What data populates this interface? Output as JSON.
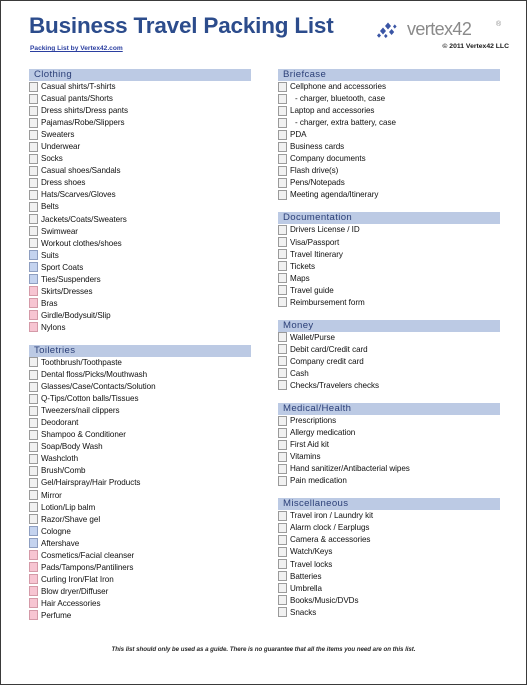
{
  "header": {
    "title": "Business Travel Packing List",
    "subtitle_link": "Packing List by Vertex42.com",
    "logo_word": "vertex42",
    "logo_tm": "®",
    "copyright": "© 2011 Vertex42 LLC"
  },
  "colors": {
    "title": "#2c4c8c",
    "section_header_bg": "#bccae4",
    "section_header_text": "#2b3f77",
    "checkbox_default": "#f1f1f1",
    "checkbox_mens": "#c4d3ef",
    "checkbox_womens": "#f7c5d2",
    "link": "#2b3fa0"
  },
  "footer": {
    "note": "This list should only be used as a guide. There is no guarantee that all the items you need are on this list."
  },
  "columns": [
    {
      "sections": [
        {
          "title": "Clothing",
          "items": [
            {
              "label": "Casual shirts/T-shirts",
              "box": "default",
              "sub": false
            },
            {
              "label": "Casual pants/Shorts",
              "box": "default",
              "sub": false
            },
            {
              "label": "Dress shirts/Dress pants",
              "box": "default",
              "sub": false
            },
            {
              "label": "Pajamas/Robe/Slippers",
              "box": "default",
              "sub": false
            },
            {
              "label": "Sweaters",
              "box": "default",
              "sub": false
            },
            {
              "label": "Underwear",
              "box": "default",
              "sub": false
            },
            {
              "label": "Socks",
              "box": "default",
              "sub": false
            },
            {
              "label": "Casual shoes/Sandals",
              "box": "default",
              "sub": false
            },
            {
              "label": "Dress shoes",
              "box": "default",
              "sub": false
            },
            {
              "label": "Hats/Scarves/Gloves",
              "box": "default",
              "sub": false
            },
            {
              "label": "Belts",
              "box": "default",
              "sub": false
            },
            {
              "label": "Jackets/Coats/Sweaters",
              "box": "default",
              "sub": false
            },
            {
              "label": "Swimwear",
              "box": "default",
              "sub": false
            },
            {
              "label": "Workout clothes/shoes",
              "box": "default",
              "sub": false
            },
            {
              "label": "Suits",
              "box": "mens",
              "sub": false
            },
            {
              "label": "Sport Coats",
              "box": "mens",
              "sub": false
            },
            {
              "label": "Ties/Suspenders",
              "box": "mens",
              "sub": false
            },
            {
              "label": "Skirts/Dresses",
              "box": "womens",
              "sub": false
            },
            {
              "label": "Bras",
              "box": "womens",
              "sub": false
            },
            {
              "label": "Girdle/Bodysuit/Slip",
              "box": "womens",
              "sub": false
            },
            {
              "label": "Nylons",
              "box": "womens",
              "sub": false
            }
          ]
        },
        {
          "title": "Toiletries",
          "items": [
            {
              "label": "Toothbrush/Toothpaste",
              "box": "default",
              "sub": false
            },
            {
              "label": "Dental floss/Picks/Mouthwash",
              "box": "default",
              "sub": false
            },
            {
              "label": "Glasses/Case/Contacts/Solution",
              "box": "default",
              "sub": false
            },
            {
              "label": "Q-Tips/Cotton balls/Tissues",
              "box": "default",
              "sub": false
            },
            {
              "label": "Tweezers/nail clippers",
              "box": "default",
              "sub": false
            },
            {
              "label": "Deodorant",
              "box": "default",
              "sub": false
            },
            {
              "label": "Shampoo & Conditioner",
              "box": "default",
              "sub": false
            },
            {
              "label": "Soap/Body Wash",
              "box": "default",
              "sub": false
            },
            {
              "label": "Washcloth",
              "box": "default",
              "sub": false
            },
            {
              "label": "Brush/Comb",
              "box": "default",
              "sub": false
            },
            {
              "label": "Gel/Hairspray/Hair Products",
              "box": "default",
              "sub": false
            },
            {
              "label": "Mirror",
              "box": "default",
              "sub": false
            },
            {
              "label": "Lotion/Lip balm",
              "box": "default",
              "sub": false
            },
            {
              "label": "Razor/Shave gel",
              "box": "default",
              "sub": false
            },
            {
              "label": "Cologne",
              "box": "mens",
              "sub": false
            },
            {
              "label": "Aftershave",
              "box": "mens",
              "sub": false
            },
            {
              "label": "Cosmetics/Facial cleanser",
              "box": "womens",
              "sub": false
            },
            {
              "label": "Pads/Tampons/Pantiliners",
              "box": "womens",
              "sub": false
            },
            {
              "label": "Curling Iron/Flat Iron",
              "box": "womens",
              "sub": false
            },
            {
              "label": "Blow dryer/Diffuser",
              "box": "womens",
              "sub": false
            },
            {
              "label": "Hair Accessories",
              "box": "womens",
              "sub": false
            },
            {
              "label": "Perfume",
              "box": "womens",
              "sub": false
            }
          ]
        }
      ]
    },
    {
      "sections": [
        {
          "title": "Briefcase",
          "items": [
            {
              "label": "Cellphone and accessories",
              "box": "default",
              "sub": false
            },
            {
              "label": "- charger, bluetooth, case",
              "box": "default",
              "sub": true
            },
            {
              "label": "Laptop and accessories",
              "box": "default",
              "sub": false
            },
            {
              "label": "- charger, extra battery, case",
              "box": "default",
              "sub": true
            },
            {
              "label": "PDA",
              "box": "default",
              "sub": false
            },
            {
              "label": "Business cards",
              "box": "default",
              "sub": false
            },
            {
              "label": "Company documents",
              "box": "default",
              "sub": false
            },
            {
              "label": "Flash drive(s)",
              "box": "default",
              "sub": false
            },
            {
              "label": "Pens/Notepads",
              "box": "default",
              "sub": false
            },
            {
              "label": "Meeting agenda/Itinerary",
              "box": "default",
              "sub": false
            }
          ]
        },
        {
          "title": "Documentation",
          "items": [
            {
              "label": "Drivers License / ID",
              "box": "default",
              "sub": false
            },
            {
              "label": "Visa/Passport",
              "box": "default",
              "sub": false
            },
            {
              "label": "Travel Itinerary",
              "box": "default",
              "sub": false
            },
            {
              "label": "Tickets",
              "box": "default",
              "sub": false
            },
            {
              "label": "Maps",
              "box": "default",
              "sub": false
            },
            {
              "label": "Travel guide",
              "box": "default",
              "sub": false
            },
            {
              "label": "Reimbursement form",
              "box": "default",
              "sub": false
            }
          ]
        },
        {
          "title": "Money",
          "items": [
            {
              "label": "Wallet/Purse",
              "box": "default",
              "sub": false
            },
            {
              "label": "Debit card/Credit card",
              "box": "default",
              "sub": false
            },
            {
              "label": "Company credit card",
              "box": "default",
              "sub": false
            },
            {
              "label": "Cash",
              "box": "default",
              "sub": false
            },
            {
              "label": "Checks/Travelers checks",
              "box": "default",
              "sub": false
            }
          ]
        },
        {
          "title": "Medical/Health",
          "items": [
            {
              "label": "Prescriptions",
              "box": "default",
              "sub": false
            },
            {
              "label": "Allergy medication",
              "box": "default",
              "sub": false
            },
            {
              "label": "First Aid kit",
              "box": "default",
              "sub": false
            },
            {
              "label": "Vitamins",
              "box": "default",
              "sub": false
            },
            {
              "label": "Hand sanitizer/Antibacterial wipes",
              "box": "default",
              "sub": false
            },
            {
              "label": "Pain medication",
              "box": "default",
              "sub": false
            }
          ]
        },
        {
          "title": "Miscellaneous",
          "items": [
            {
              "label": "Travel iron / Laundry kit",
              "box": "default",
              "sub": false
            },
            {
              "label": "Alarm clock / Earplugs",
              "box": "default",
              "sub": false
            },
            {
              "label": "Camera & accessories",
              "box": "default",
              "sub": false
            },
            {
              "label": "Watch/Keys",
              "box": "default",
              "sub": false
            },
            {
              "label": "Travel locks",
              "box": "default",
              "sub": false
            },
            {
              "label": "Batteries",
              "box": "default",
              "sub": false
            },
            {
              "label": "Umbrella",
              "box": "default",
              "sub": false
            },
            {
              "label": "Books/Music/DVDs",
              "box": "default",
              "sub": false
            },
            {
              "label": "Snacks",
              "box": "default",
              "sub": false
            }
          ]
        }
      ]
    }
  ]
}
